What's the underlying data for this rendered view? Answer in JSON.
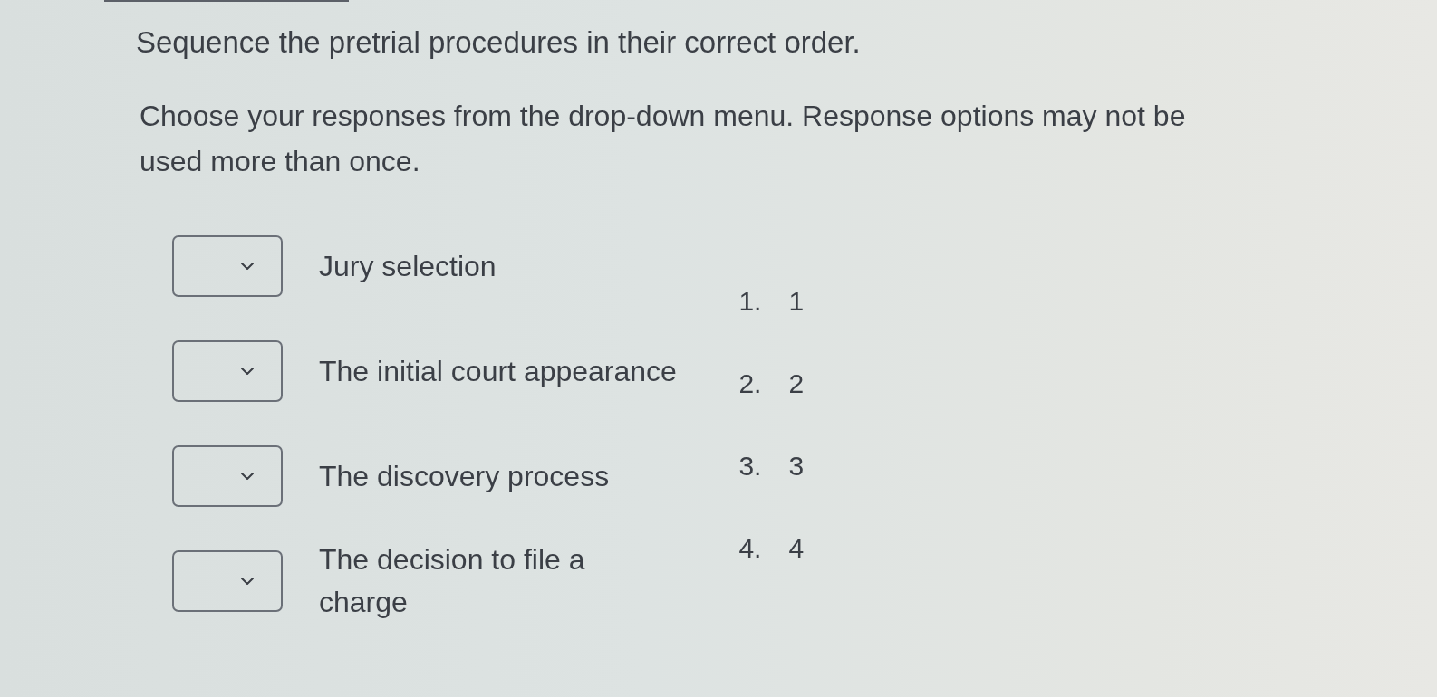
{
  "question": {
    "title": "Sequence the pretrial procedures in their correct order.",
    "instructions": "Choose your responses from the drop-down menu. Response options may not be used more than once."
  },
  "items": [
    {
      "label": "Jury selection"
    },
    {
      "label": "The initial court appearance"
    },
    {
      "label": "The discovery process"
    },
    {
      "label": "The decision to file a charge"
    }
  ],
  "options": [
    {
      "number": "1.",
      "text": "1"
    },
    {
      "number": "2.",
      "text": "2"
    },
    {
      "number": "3.",
      "text": "3"
    },
    {
      "number": "4.",
      "text": "4"
    }
  ]
}
